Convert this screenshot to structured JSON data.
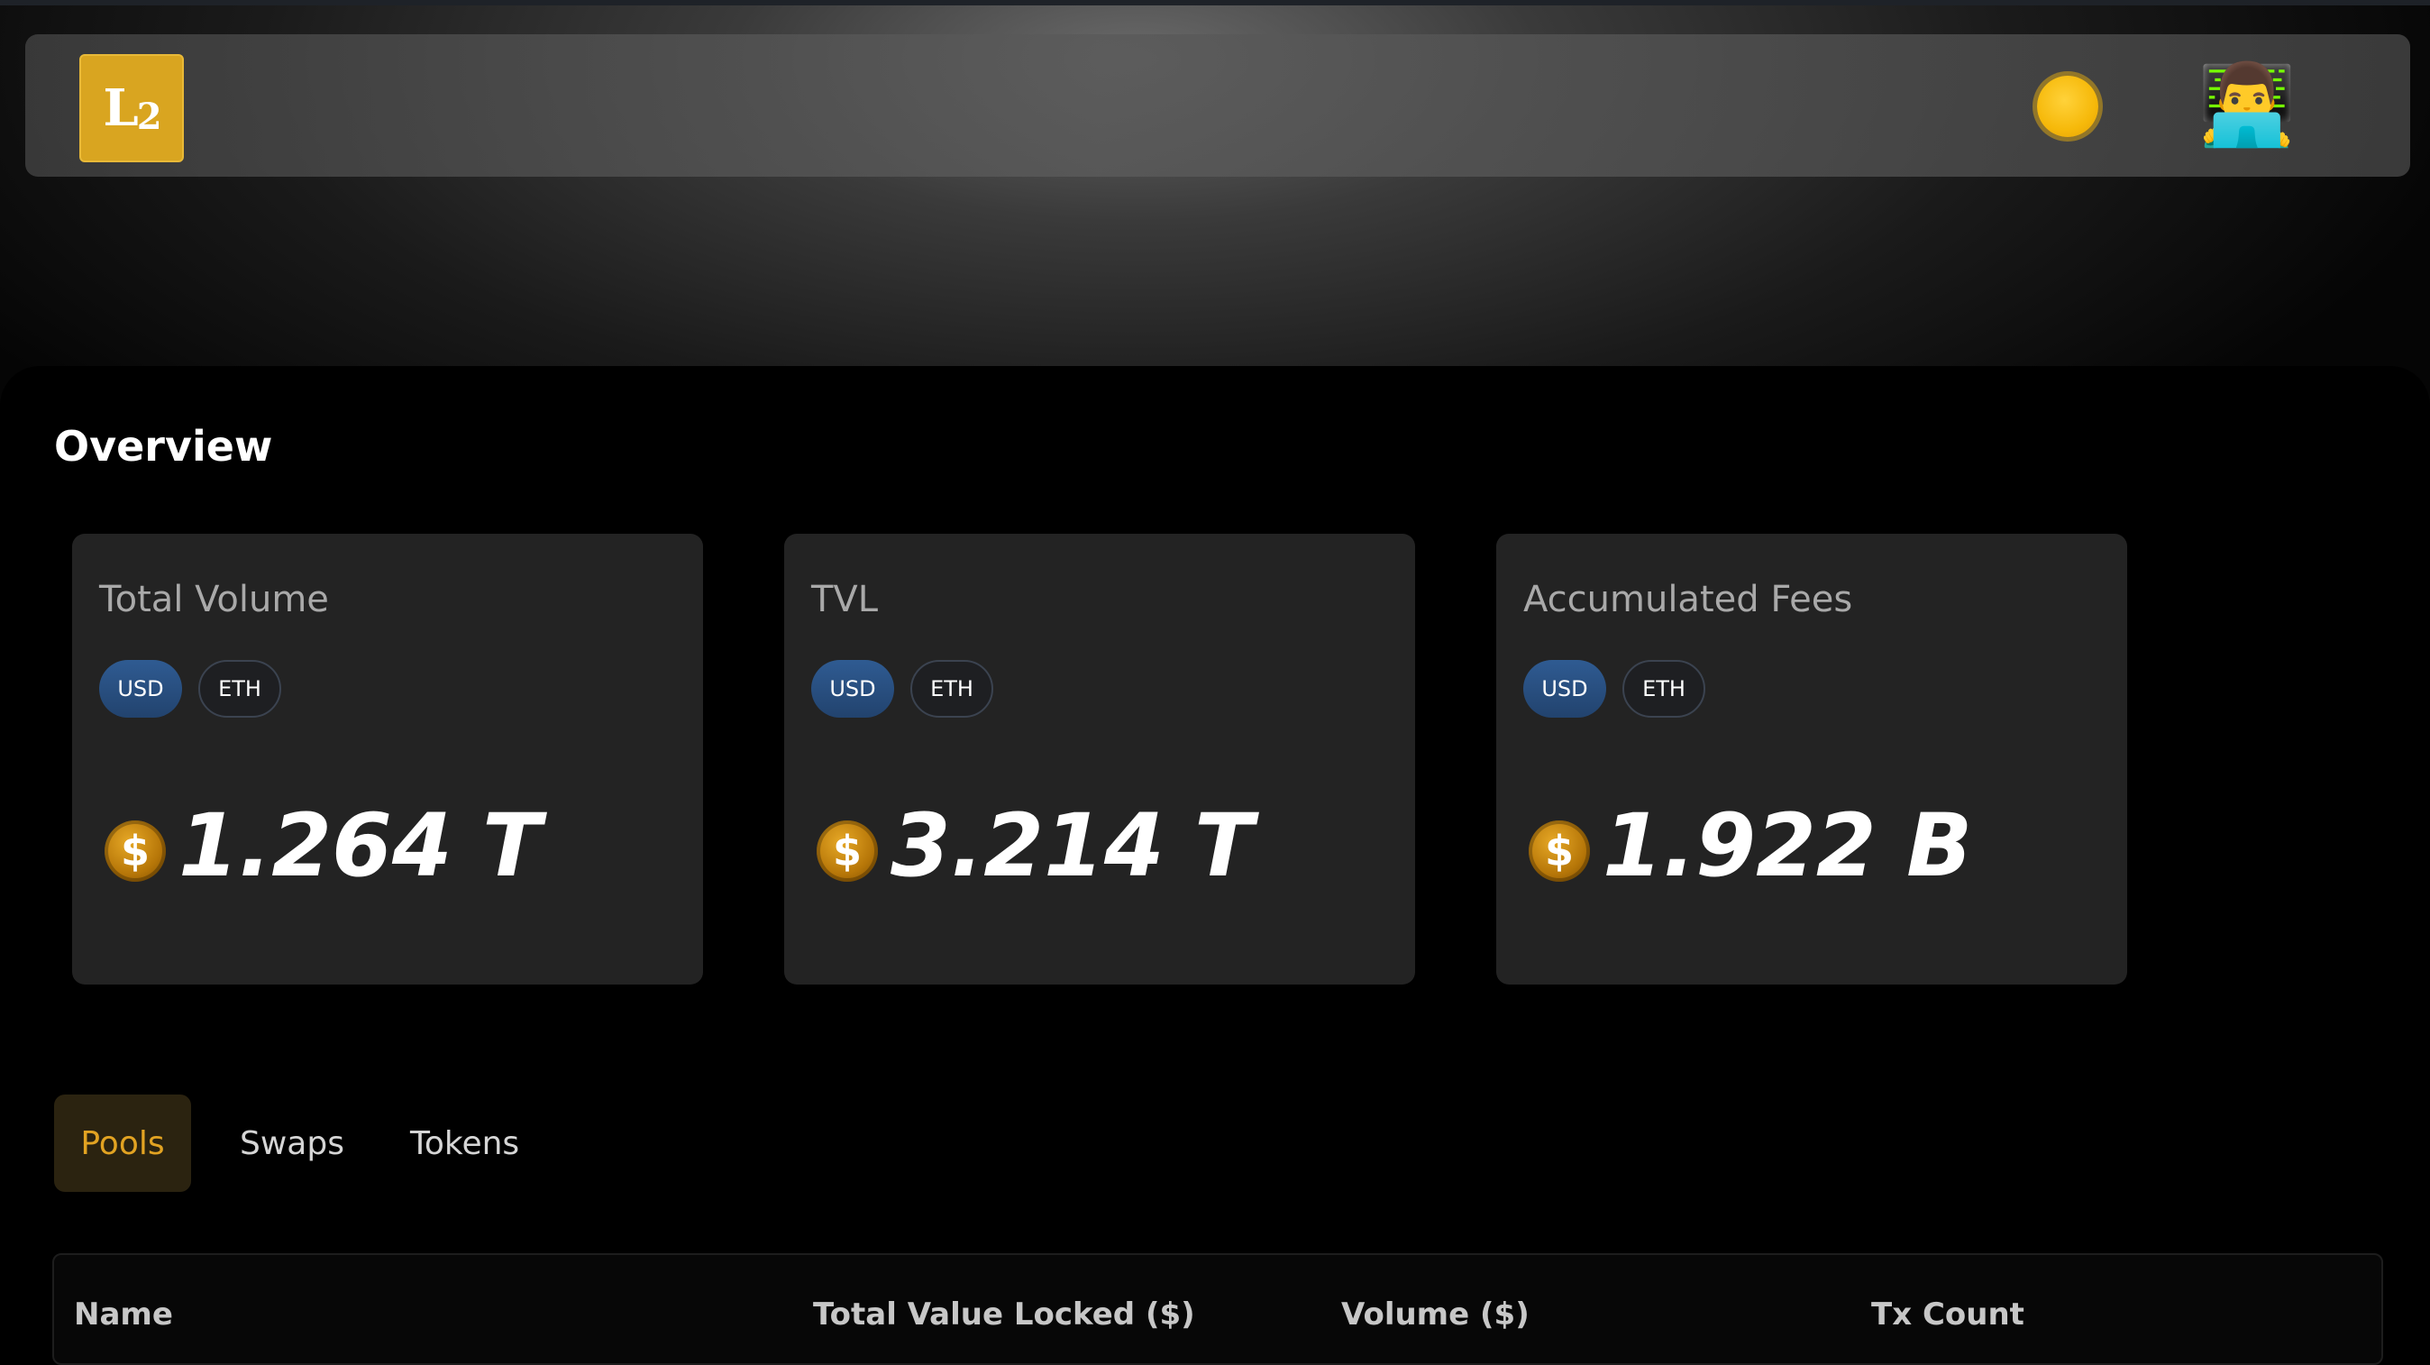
{
  "header": {
    "logo_text": "L",
    "logo_sub": "2",
    "theme_icon": "sun-icon",
    "avatar_emoji": "👨‍💻"
  },
  "overview": {
    "title": "Overview",
    "cards": [
      {
        "title": "Total Volume",
        "usd_label": "USD",
        "eth_label": "ETH",
        "currency_symbol": "$",
        "value": "1.264 T"
      },
      {
        "title": "TVL",
        "usd_label": "USD",
        "eth_label": "ETH",
        "currency_symbol": "$",
        "value": "3.214 T"
      },
      {
        "title": "Accumulated Fees",
        "usd_label": "USD",
        "eth_label": "ETH",
        "currency_symbol": "$",
        "value": "1.922 B"
      }
    ]
  },
  "tabs": [
    {
      "label": "Pools",
      "active": true
    },
    {
      "label": "Swaps",
      "active": false
    },
    {
      "label": "Tokens",
      "active": false
    }
  ],
  "table": {
    "columns": [
      "Name",
      "Total Value Locked ($)",
      "Volume ($)",
      "Tx Count"
    ]
  },
  "colors": {
    "accent": "#e2a322",
    "usd_pill": "#2f5b92",
    "card_bg": "#232323"
  }
}
